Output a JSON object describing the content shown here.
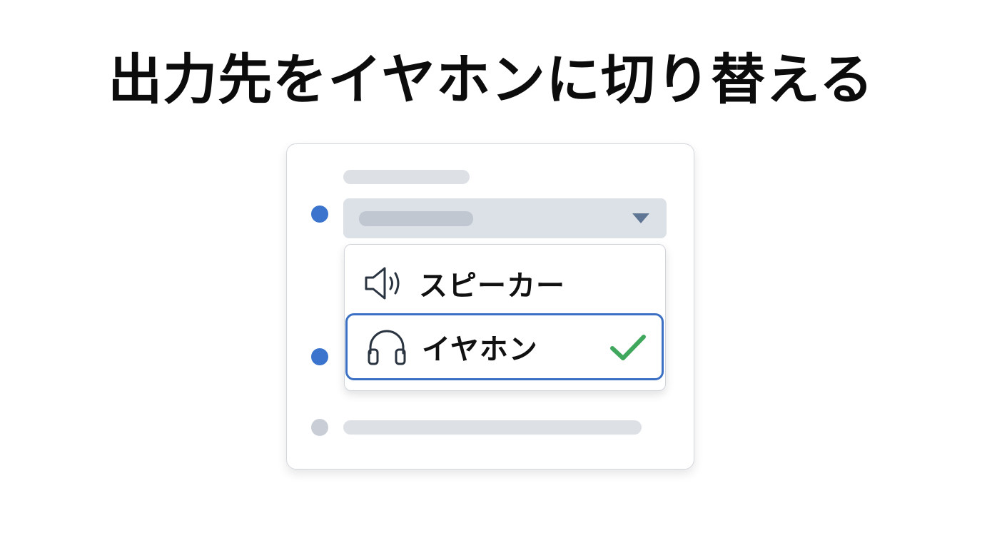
{
  "page": {
    "title": "出力先をイヤホンに切り替える"
  },
  "settings_card": {
    "selector": {
      "current_value": ""
    },
    "menu": {
      "items": [
        {
          "label": "スピーカー",
          "icon": "speaker-icon",
          "selected": false
        },
        {
          "label": "イヤホン",
          "icon": "headphones-icon",
          "selected": true
        }
      ]
    }
  },
  "colors": {
    "accent": "#3a6fc3",
    "check": "#3fa85c",
    "placeholder": "#dde0e5",
    "inactive_bullet": "#c9ced6"
  }
}
